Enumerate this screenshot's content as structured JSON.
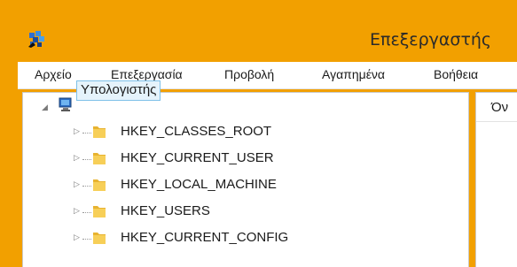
{
  "window": {
    "title": "Επεξεργαστής"
  },
  "menu": {
    "items": [
      "Αρχείο",
      "Επεξεργασία",
      "Προβολή",
      "Αγαπημένα",
      "Βοήθεια"
    ]
  },
  "tree": {
    "root": "Υπολογιστής",
    "keys": [
      "HKEY_CLASSES_ROOT",
      "HKEY_CURRENT_USER",
      "HKEY_LOCAL_MACHINE",
      "HKEY_USERS",
      "HKEY_CURRENT_CONFIG"
    ]
  },
  "list": {
    "column_header": "Όν"
  },
  "colors": {
    "accent": "#f2a000",
    "selection": "#e5f3fb",
    "folder": "#f5c544"
  }
}
